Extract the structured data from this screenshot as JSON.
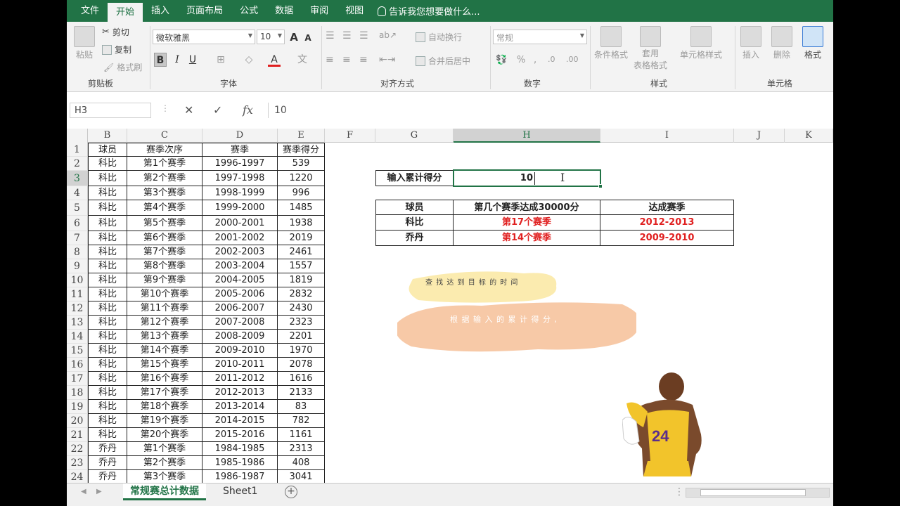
{
  "ribbon_tabs": [
    "文件",
    "开始",
    "插入",
    "页面布局",
    "公式",
    "数据",
    "审阅",
    "视图"
  ],
  "active_tab": "开始",
  "tell_me": "告诉我您想要做什么...",
  "clipboard": {
    "paste": "粘贴",
    "cut": "剪切",
    "copy": "复制",
    "format_painter": "格式刷",
    "label": "剪贴板"
  },
  "font": {
    "name": "微软雅黑",
    "size": "10",
    "label": "字体",
    "bold": "B",
    "italic": "I",
    "underline": "U",
    "grow": "A",
    "shrink": "A",
    "font_color": "A"
  },
  "alignment": {
    "wrap": "自动换行",
    "merge": "合并后居中",
    "label": "对齐方式"
  },
  "number": {
    "format": "常规",
    "label": "数字"
  },
  "styles": {
    "conditional": "条件格式",
    "table_line1": "套用",
    "table_line2": "表格格式",
    "cell_styles": "单元格样式",
    "label": "样式"
  },
  "cells": {
    "insert": "插入",
    "delete": "删除",
    "format": "格式",
    "label": "单元格"
  },
  "formula_bar": {
    "name_box": "H3",
    "cancel": "✕",
    "enter": "✓",
    "fx": "fx",
    "content": "10"
  },
  "columns": [
    "B",
    "C",
    "D",
    "E",
    "F",
    "G",
    "H",
    "I",
    "J",
    "K"
  ],
  "rows": [
    "1",
    "2",
    "3",
    "4",
    "5",
    "6",
    "7",
    "8",
    "9",
    "10",
    "11",
    "12",
    "13",
    "14",
    "15",
    "16",
    "17",
    "18",
    "19",
    "20",
    "21",
    "22",
    "23",
    "24"
  ],
  "table": {
    "headers": [
      "球员",
      "赛季次序",
      "赛季",
      "赛季得分"
    ],
    "data": [
      [
        "科比",
        "第1个赛季",
        "1996-1997",
        "539"
      ],
      [
        "科比",
        "第2个赛季",
        "1997-1998",
        "1220"
      ],
      [
        "科比",
        "第3个赛季",
        "1998-1999",
        "996"
      ],
      [
        "科比",
        "第4个赛季",
        "1999-2000",
        "1485"
      ],
      [
        "科比",
        "第5个赛季",
        "2000-2001",
        "1938"
      ],
      [
        "科比",
        "第6个赛季",
        "2001-2002",
        "2019"
      ],
      [
        "科比",
        "第7个赛季",
        "2002-2003",
        "2461"
      ],
      [
        "科比",
        "第8个赛季",
        "2003-2004",
        "1557"
      ],
      [
        "科比",
        "第9个赛季",
        "2004-2005",
        "1819"
      ],
      [
        "科比",
        "第10个赛季",
        "2005-2006",
        "2832"
      ],
      [
        "科比",
        "第11个赛季",
        "2006-2007",
        "2430"
      ],
      [
        "科比",
        "第12个赛季",
        "2007-2008",
        "2323"
      ],
      [
        "科比",
        "第13个赛季",
        "2008-2009",
        "2201"
      ],
      [
        "科比",
        "第14个赛季",
        "2009-2010",
        "1970"
      ],
      [
        "科比",
        "第15个赛季",
        "2010-2011",
        "2078"
      ],
      [
        "科比",
        "第16个赛季",
        "2011-2012",
        "1616"
      ],
      [
        "科比",
        "第17个赛季",
        "2012-2013",
        "2133"
      ],
      [
        "科比",
        "第18个赛季",
        "2013-2014",
        "83"
      ],
      [
        "科比",
        "第19个赛季",
        "2014-2015",
        "782"
      ],
      [
        "科比",
        "第20个赛季",
        "2015-2016",
        "1161"
      ],
      [
        "乔丹",
        "第1个赛季",
        "1984-1985",
        "2313"
      ],
      [
        "乔丹",
        "第2个赛季",
        "1985-1986",
        "408"
      ],
      [
        "乔丹",
        "第3个赛季",
        "1986-1987",
        "3041"
      ]
    ]
  },
  "input_box": {
    "label": "输入累计得分",
    "value": "10"
  },
  "result": {
    "headers": [
      "球员",
      "第几个赛季达成30000分",
      "达成赛季"
    ],
    "rows": [
      [
        "科比",
        "第17个赛季",
        "2012-2013"
      ],
      [
        "乔丹",
        "第14个赛季",
        "2009-2010"
      ]
    ]
  },
  "annotations": {
    "line1": "查 找 达 到 目 标 的 时 间",
    "line2": "根 据 输 入 的 累 计 得 分 ,"
  },
  "sheet_tabs": [
    "常规赛总计数据",
    "Sheet1"
  ],
  "active_sheet": "常规赛总计数据",
  "colors": {
    "excel_green": "#217346",
    "result_red": "#e02020",
    "brush_yellow": "#fbe9a6",
    "brush_orange": "#f6c39d"
  }
}
